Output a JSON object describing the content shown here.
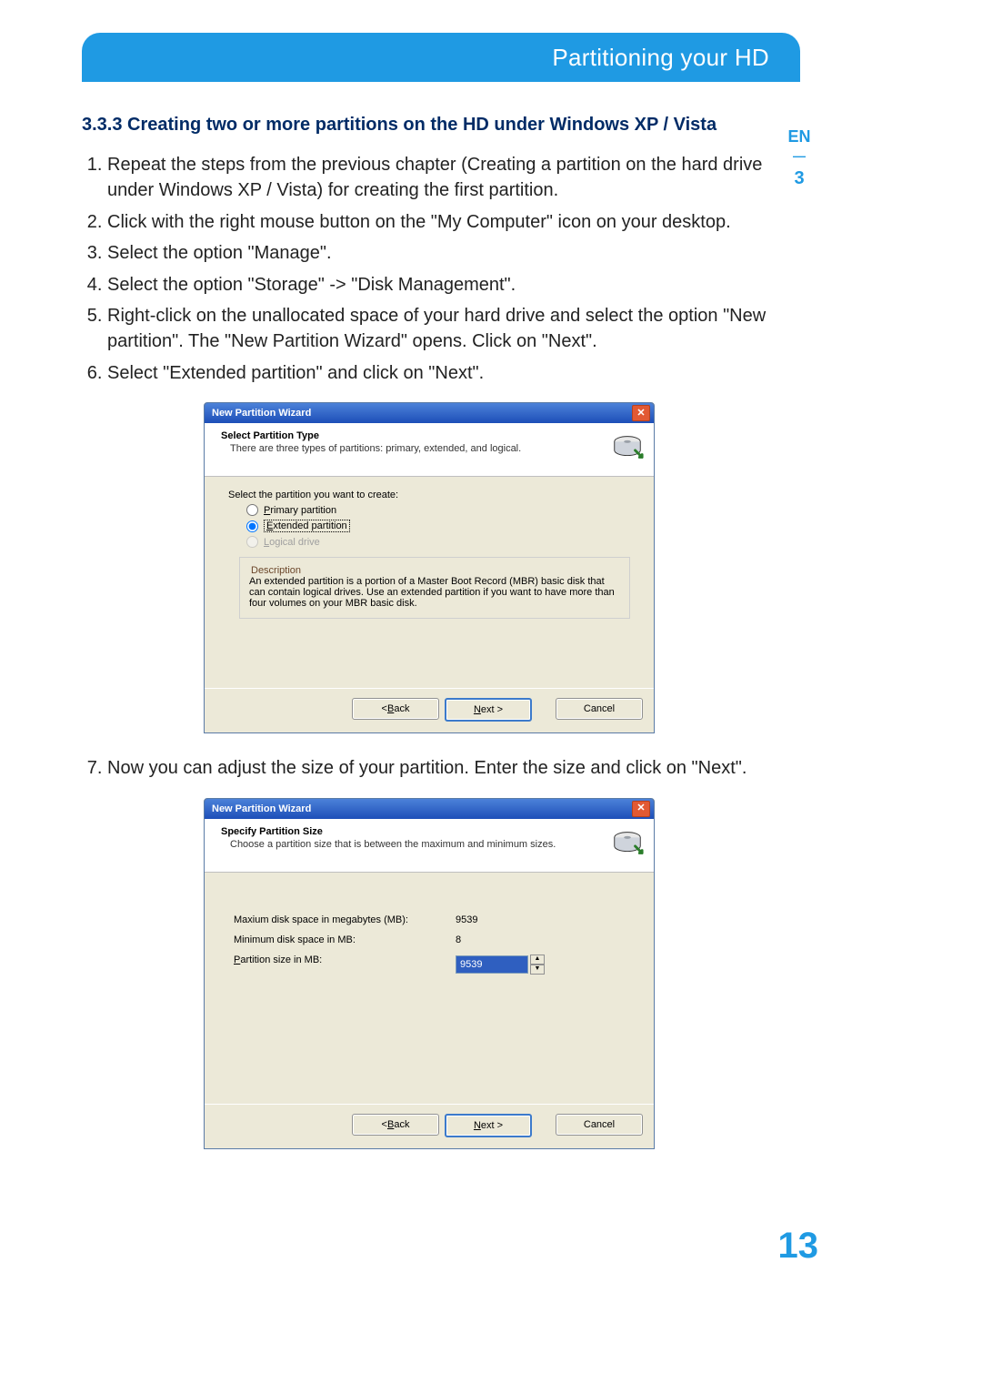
{
  "banner_title": "Partitioning your HD",
  "thumb": {
    "lang": "EN",
    "chapter": "3"
  },
  "page_number": "13",
  "heading": "3.3.3  Creating two or more partitions on the HD under Windows XP / Vista",
  "steps": [
    "Repeat the steps from the previous chapter (Creating a partition on the hard drive under Windows XP / Vista) for creating the first partition.",
    "Click with the right mouse button on the \"My Computer\" icon on your desktop.",
    "Select the option \"Manage\".",
    "Select the option \"Storage\" -> \"Disk Management\".",
    "Right-click on the unallocated space of your hard drive and select the option \"New partition\". The \"New Partition Wizard\" opens. Click on \"Next\".",
    "Select \"Extended partition\" and click on \"Next\"."
  ],
  "step7": "Now you can adjust the size of your partition. Enter the size and click on \"Next\".",
  "wizard1": {
    "title": "New Partition Wizard",
    "close_glyph": "✕",
    "header_title": "Select Partition Type",
    "header_sub": "There are three types of partitions: primary, extended, and logical.",
    "body_lead": "Select the partition you want to create:",
    "opt_primary_pre": "P",
    "opt_primary_rest": "rimary partition",
    "opt_ext_pre": "E",
    "opt_ext_rest": "xtended partition",
    "opt_log_pre": "L",
    "opt_log_rest": "ogical drive",
    "desc_label": "Description",
    "desc_text": "An extended partition is a portion of a Master Boot Record (MBR) basic disk that can contain logical drives. Use an extended partition if you want to have more than four volumes on your MBR basic disk.",
    "btn_back_pre": "< ",
    "btn_back_u": "B",
    "btn_back_rest": "ack",
    "btn_next_u": "N",
    "btn_next_rest": "ext >",
    "btn_cancel": "Cancel"
  },
  "wizard2": {
    "title": "New Partition Wizard",
    "close_glyph": "✕",
    "header_title": "Specify Partition Size",
    "header_sub": "Choose a partition size that is between the maximum and minimum sizes.",
    "row_max_label": "Maxium disk space in megabytes (MB):",
    "row_max_value": "9539",
    "row_min_label": "Minimum disk space in MB:",
    "row_min_value": "8",
    "row_size_pre": "P",
    "row_size_rest": "artition size in MB:",
    "row_size_value": "9539",
    "btn_back_pre": "< ",
    "btn_back_u": "B",
    "btn_back_rest": "ack",
    "btn_next_u": "N",
    "btn_next_rest": "ext >",
    "btn_cancel": "Cancel"
  }
}
